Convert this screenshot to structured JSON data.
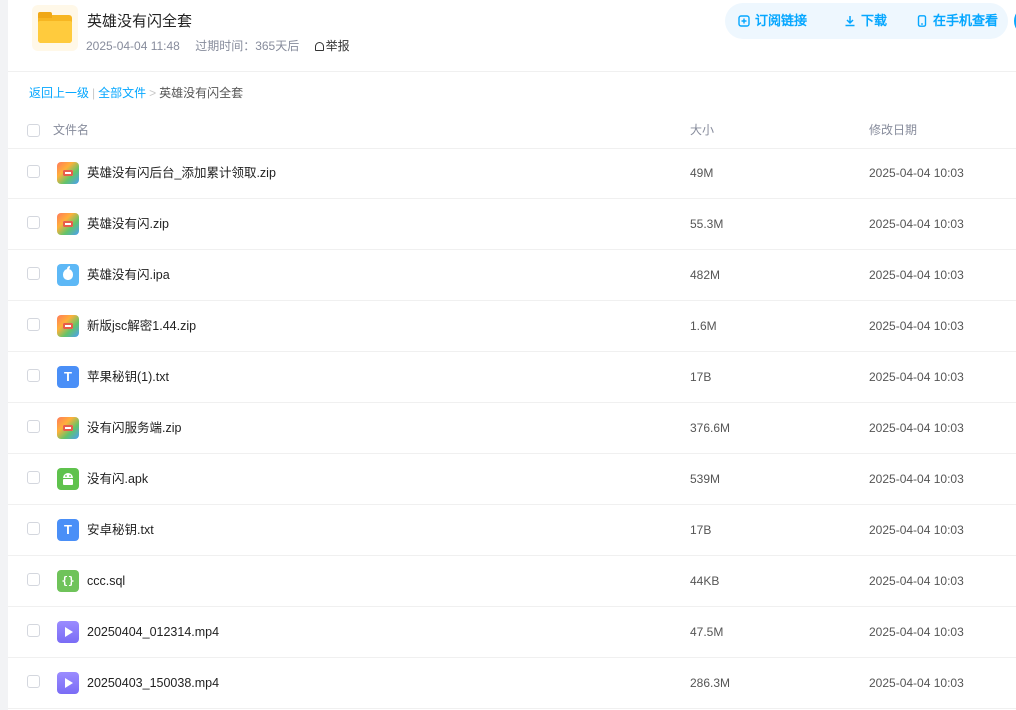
{
  "share": {
    "title": "英雄没有闪全套",
    "created": "2025-04-04 11:48",
    "expire": "过期时间：365天后",
    "report": "举报"
  },
  "actions": {
    "subscribe": "订阅链接",
    "download": "下载",
    "mobile": "在手机查看"
  },
  "breadcrumb": {
    "back": "返回上一级",
    "sep": "|",
    "all": "全部文件",
    "arrow": ">",
    "current": "英雄没有闪全套"
  },
  "columns": {
    "name": "文件名",
    "size": "大小",
    "date": "修改日期"
  },
  "files": [
    {
      "name": "英雄没有闪后台_添加累计领取.zip",
      "size": "49M",
      "date": "2025-04-04 10:03",
      "type": "zip",
      "icon": "zip-icon"
    },
    {
      "name": "英雄没有闪.zip",
      "size": "55.3M",
      "date": "2025-04-04 10:03",
      "type": "zip",
      "icon": "zip-icon"
    },
    {
      "name": "英雄没有闪.ipa",
      "size": "482M",
      "date": "2025-04-04 10:03",
      "type": "ipa",
      "icon": "ipa-icon"
    },
    {
      "name": "新版jsc解密1.44.zip",
      "size": "1.6M",
      "date": "2025-04-04 10:03",
      "type": "zip",
      "icon": "zip-icon"
    },
    {
      "name": "苹果秘钥(1).txt",
      "size": "17B",
      "date": "2025-04-04 10:03",
      "type": "txt",
      "icon": "txt-icon",
      "glyph": "T"
    },
    {
      "name": "没有闪服务端.zip",
      "size": "376.6M",
      "date": "2025-04-04 10:03",
      "type": "zip",
      "icon": "zip-icon"
    },
    {
      "name": "没有闪.apk",
      "size": "539M",
      "date": "2025-04-04 10:03",
      "type": "apk",
      "icon": "apk-icon"
    },
    {
      "name": "安卓秘钥.txt",
      "size": "17B",
      "date": "2025-04-04 10:03",
      "type": "txt",
      "icon": "txt-icon",
      "glyph": "T"
    },
    {
      "name": "ccc.sql",
      "size": "44KB",
      "date": "2025-04-04 10:03",
      "type": "sql",
      "icon": "sql-icon",
      "glyph": "{}"
    },
    {
      "name": "20250404_012314.mp4",
      "size": "47.5M",
      "date": "2025-04-04 10:03",
      "type": "mp4",
      "icon": "video-icon"
    },
    {
      "name": "20250403_150038.mp4",
      "size": "286.3M",
      "date": "2025-04-04 10:03",
      "type": "mp4",
      "icon": "video-icon"
    }
  ],
  "colors": {
    "accent": "#06a7ff",
    "folder": "#ffcb3d"
  }
}
